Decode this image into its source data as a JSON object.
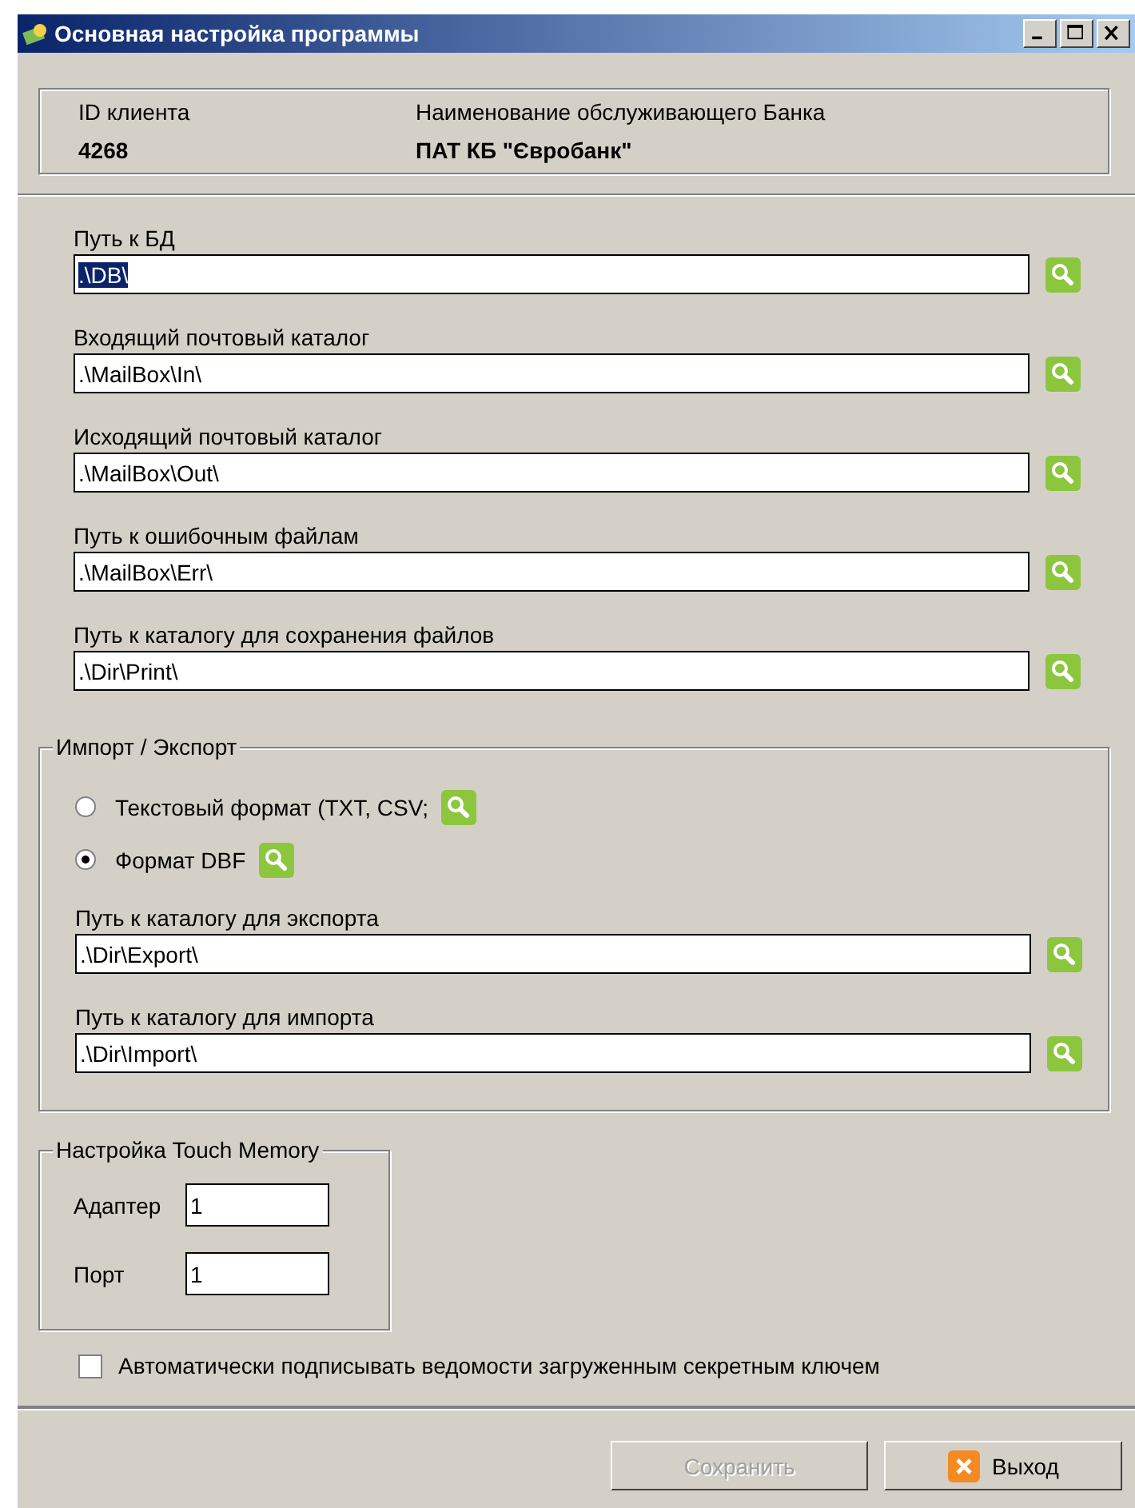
{
  "window": {
    "title": "Основная настройка программы"
  },
  "client": {
    "id_label": "ID клиента",
    "id": "4268",
    "bank_label": "Наименование обслуживающего Банка",
    "bank": "ПАТ КБ \"Євробанк\""
  },
  "paths": [
    {
      "label": "Путь к БД",
      "value": ".\\DB\\",
      "text_selected": true
    },
    {
      "label": "Входящий почтовый каталог",
      "value": ".\\MailBox\\In\\",
      "text_selected": false
    },
    {
      "label": "Исходящий почтовый каталог",
      "value": ".\\MailBox\\Out\\",
      "text_selected": false
    },
    {
      "label": "Путь к ошибочным файлам",
      "value": ".\\MailBox\\Err\\",
      "text_selected": false
    },
    {
      "label": "Путь к каталогу для сохранения файлов",
      "value": ".\\Dir\\Print\\",
      "text_selected": false
    }
  ],
  "import_export": {
    "title": "Импорт / Экспорт",
    "formats": [
      {
        "label": "Текстовый формат (TXT, CSV;",
        "selected": false
      },
      {
        "label": "Формат DBF",
        "selected": true
      }
    ],
    "paths": [
      {
        "label": "Путь к каталогу для экспорта",
        "value": ".\\Dir\\Export\\",
        "text_selected": false
      },
      {
        "label": "Путь к каталогу для импорта",
        "value": ".\\Dir\\Import\\",
        "text_selected": false
      }
    ]
  },
  "touch_memory": {
    "title": "Настройка Touch Memory",
    "fields": [
      {
        "label": "Адаптер",
        "value": "1"
      },
      {
        "label": "Порт",
        "value": "1"
      }
    ]
  },
  "auto_sign": {
    "label": "Автоматически подписывать ведомости загруженным секретным ключем",
    "checked": false
  },
  "buttons": [
    {
      "label": "Сохранить",
      "disabled": true,
      "kind": "plain"
    },
    {
      "label": "Выход",
      "disabled": false,
      "kind": "exit"
    }
  ]
}
